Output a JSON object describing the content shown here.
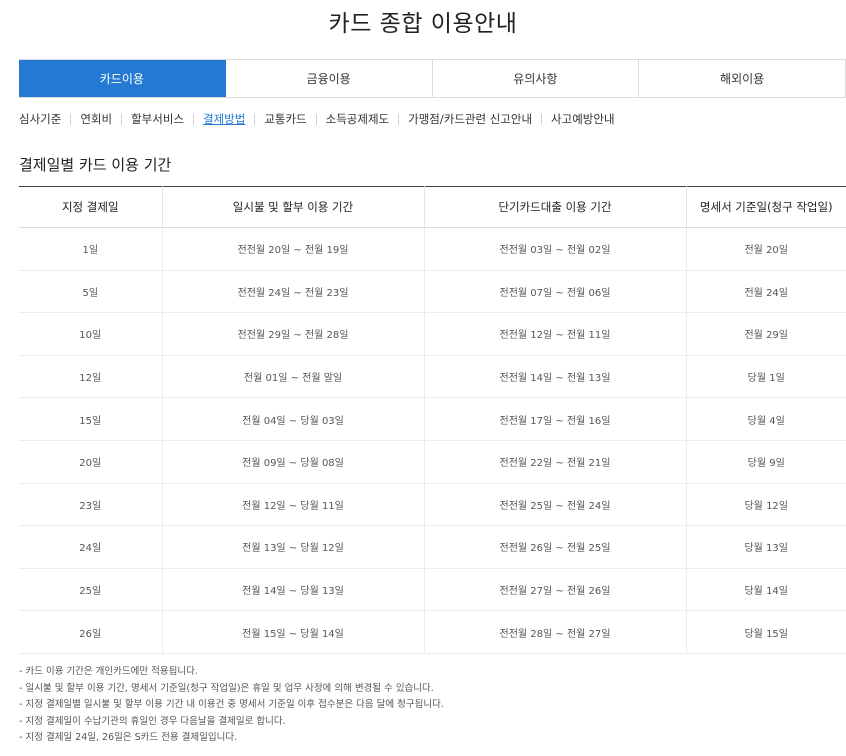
{
  "page": {
    "title": "카드 종합 이용안내"
  },
  "tabs": [
    {
      "label": "카드이용",
      "active": true
    },
    {
      "label": "금융이용",
      "active": false
    },
    {
      "label": "유의사항",
      "active": false
    },
    {
      "label": "해외이용",
      "active": false
    }
  ],
  "subnav": [
    {
      "label": "심사기준",
      "active": false
    },
    {
      "label": "연회비",
      "active": false
    },
    {
      "label": "할부서비스",
      "active": false
    },
    {
      "label": "결제방법",
      "active": true
    },
    {
      "label": "교통카드",
      "active": false
    },
    {
      "label": "소득공제제도",
      "active": false
    },
    {
      "label": "가맹점/카드관련 신고안내",
      "active": false
    },
    {
      "label": "사고예방안내",
      "active": false
    }
  ],
  "section": {
    "heading": "결제일별 카드 이용 기간"
  },
  "table": {
    "headers": [
      "지정 결제일",
      "일시불 및 할부 이용 기간",
      "단기카드대출 이용 기간",
      "명세서 기준일(청구 작업일)"
    ],
    "rows": [
      [
        "1일",
        "전전월 20일 ~ 전월 19일",
        "전전월 03일 ~ 전월 02일",
        "전월 20일"
      ],
      [
        "5일",
        "전전월 24일 ~ 전월 23일",
        "전전월 07일 ~ 전월 06일",
        "전월 24일"
      ],
      [
        "10일",
        "전전월 29일 ~ 전월 28일",
        "전전월 12일 ~ 전월 11일",
        "전월 29일"
      ],
      [
        "12일",
        "전월 01일 ~ 전월 말일",
        "전전월 14일 ~ 전월 13일",
        "당월 1일"
      ],
      [
        "15일",
        "전월 04일 ~ 당월 03일",
        "전전월 17일 ~ 전월 16일",
        "당월 4일"
      ],
      [
        "20일",
        "전월 09일 ~ 당월 08일",
        "전전월 22일 ~ 전월 21일",
        "당월 9일"
      ],
      [
        "23일",
        "전월 12일 ~ 당월 11일",
        "전전월 25일 ~ 전월 24일",
        "당월 12일"
      ],
      [
        "24일",
        "전월 13일 ~ 당월 12일",
        "전전월 26일 ~ 전월 25일",
        "당월 13일"
      ],
      [
        "25일",
        "전월 14일 ~ 당월 13일",
        "전전월 27일 ~ 전월 26일",
        "당월 14일"
      ],
      [
        "26일",
        "전월 15일 ~ 당월 14일",
        "전전월 28일 ~ 전월 27일",
        "당월 15일"
      ]
    ]
  },
  "notes": [
    "- 카드 이용 기간은 개인카드에만 적용됩니다.",
    "- 일시불 및 할부 이용 기간, 명세서 기준일(청구 작업일)은 휴일 및 업무 사정에 의해 변경될 수 있습니다.",
    "- 지정 결제일별 일시불 및 할부 이용 기간 내 이용건 중 명세서 기준일 이후 접수분은 다음 달에 청구됩니다.",
    "- 지정 결제일이 수납기관의 휴일인 경우 다음날을 결제일로 합니다.",
    "- 지정 결제일 24일, 26일은 S카드 전용 결제일입니다."
  ],
  "colors": {
    "accent": "#2479d3"
  }
}
